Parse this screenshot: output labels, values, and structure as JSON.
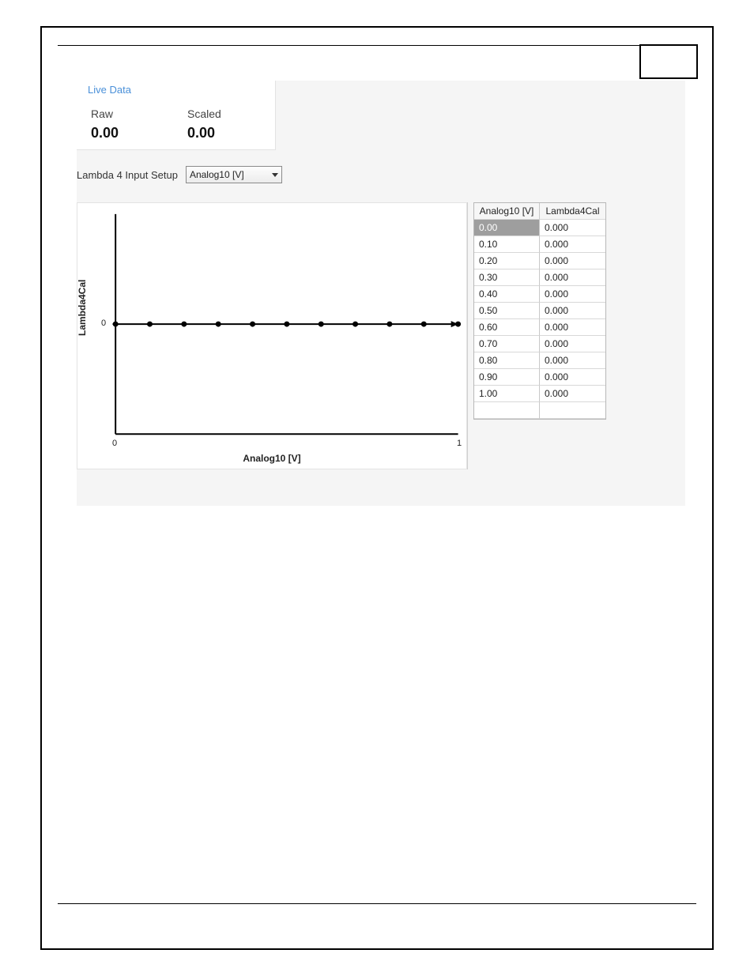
{
  "live_data": {
    "title": "Live Data",
    "raw_label": "Raw",
    "raw_value": "0.00",
    "scaled_label": "Scaled",
    "scaled_value": "0.00"
  },
  "setup": {
    "label": "Lambda 4 Input Setup",
    "selected": "Analog10 [V]"
  },
  "table": {
    "headers": [
      "Analog10 [V]",
      "Lambda4Cal"
    ],
    "rows": [
      [
        "0.00",
        "0.000"
      ],
      [
        "0.10",
        "0.000"
      ],
      [
        "0.20",
        "0.000"
      ],
      [
        "0.30",
        "0.000"
      ],
      [
        "0.40",
        "0.000"
      ],
      [
        "0.50",
        "0.000"
      ],
      [
        "0.60",
        "0.000"
      ],
      [
        "0.70",
        "0.000"
      ],
      [
        "0.80",
        "0.000"
      ],
      [
        "0.90",
        "0.000"
      ],
      [
        "1.00",
        "0.000"
      ]
    ],
    "selected_row": 0
  },
  "chart_data": {
    "type": "scatter",
    "title": "",
    "xlabel": "Analog10 [V]",
    "ylabel": "Lambda4Cal",
    "xlim": [
      0,
      1
    ],
    "ylim": [
      -1,
      1
    ],
    "xticks": [
      "0",
      "1"
    ],
    "yticks": [
      "0"
    ],
    "x": [
      0.0,
      0.1,
      0.2,
      0.3,
      0.4,
      0.5,
      0.6,
      0.7,
      0.8,
      0.9,
      1.0
    ],
    "values": [
      0.0,
      0.0,
      0.0,
      0.0,
      0.0,
      0.0,
      0.0,
      0.0,
      0.0,
      0.0,
      0.0
    ]
  }
}
